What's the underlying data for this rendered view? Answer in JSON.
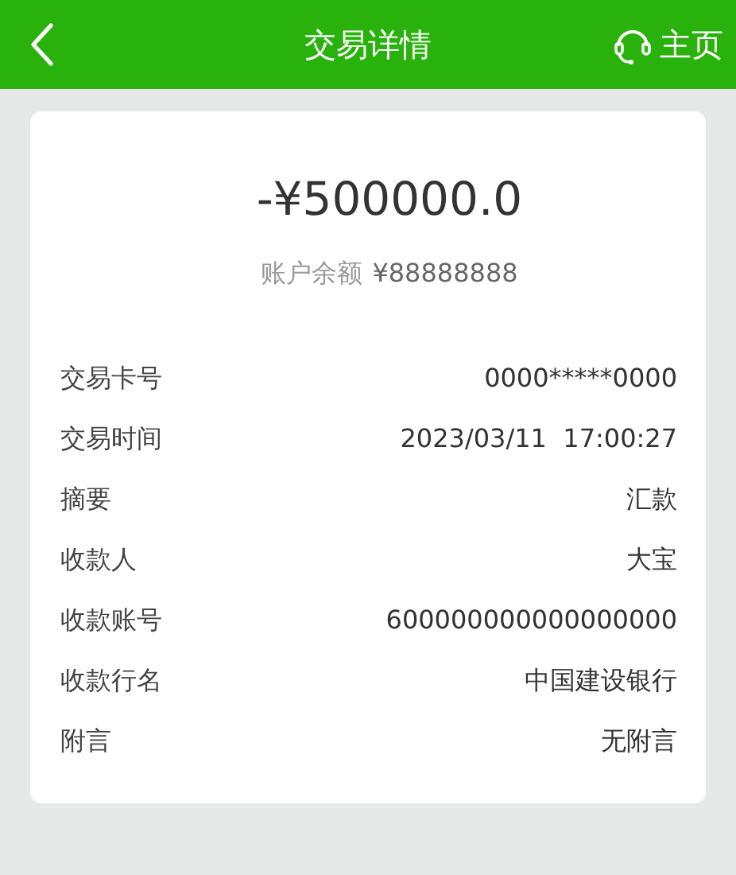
{
  "header": {
    "title": "交易详情",
    "home_label": "主页"
  },
  "amount": "-¥500000.0",
  "balance": {
    "label": "账户余额",
    "value": "¥88888888"
  },
  "details": [
    {
      "label": "交易卡号",
      "value": "0000*****0000"
    },
    {
      "label": "交易时间",
      "value": "2023/03/11  17:00:27"
    },
    {
      "label": "摘要",
      "value": "汇款"
    },
    {
      "label": "收款人",
      "value": "大宝"
    },
    {
      "label": "收款账号",
      "value": "600000000000000000"
    },
    {
      "label": "收款行名",
      "value": "中国建设银行"
    },
    {
      "label": "附言",
      "value": "无附言"
    }
  ]
}
